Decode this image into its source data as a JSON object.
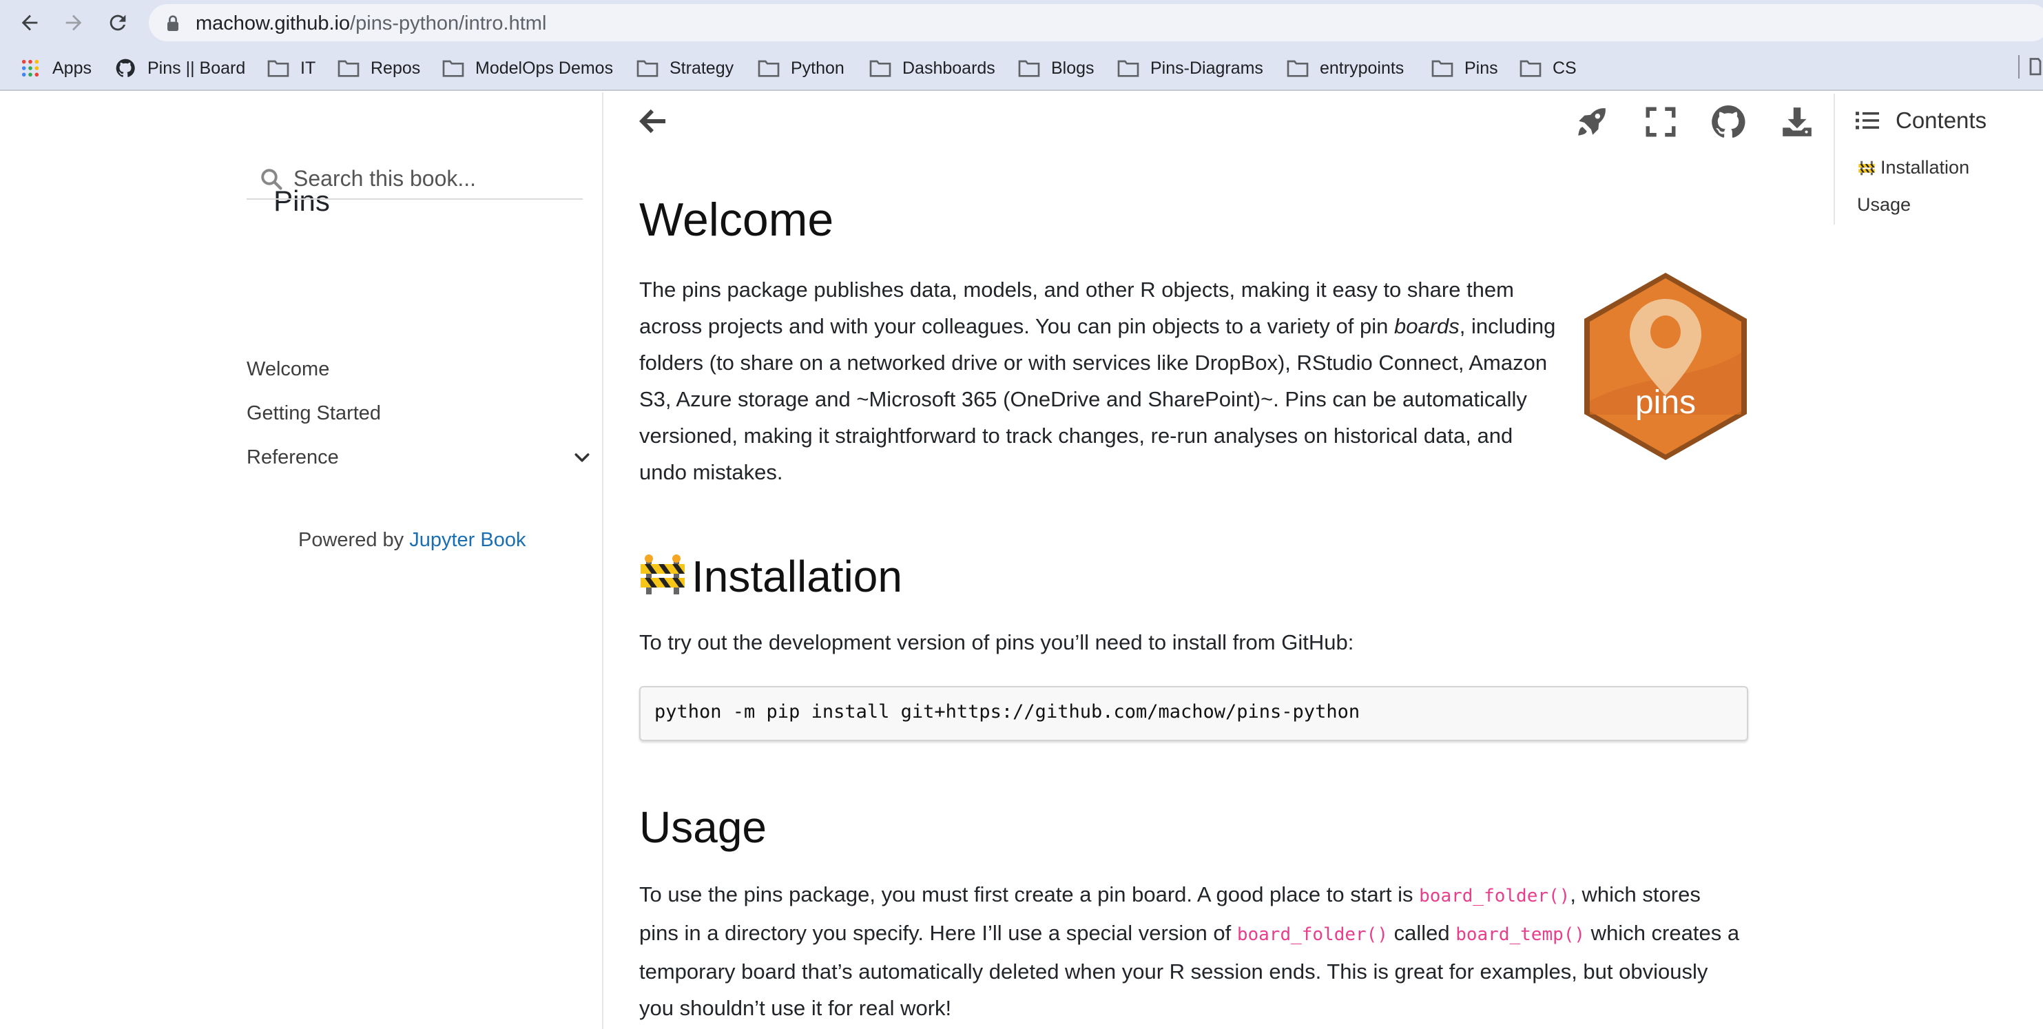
{
  "browser": {
    "url_host": "machow.github.io",
    "url_path": "/pins-python/intro.html",
    "bookmarks": [
      "Apps",
      "Pins || Board",
      "IT",
      "Repos",
      "ModelOps Demos",
      "Strategy",
      "Python",
      "Dashboards",
      "Blogs",
      "Pins-Diagrams",
      "entrypoints",
      "Pins",
      "CS"
    ]
  },
  "sidebar": {
    "site_title": "Pins",
    "search_placeholder": "Search this book...",
    "nav": [
      "Welcome",
      "Getting Started",
      "Reference"
    ],
    "powered_prefix": "Powered by ",
    "powered_link": "Jupyter Book"
  },
  "toc": {
    "title": "Contents",
    "items": [
      "Installation",
      "Usage"
    ]
  },
  "content": {
    "welcome_title": "Welcome",
    "welcome_p1": "The pins package publishes data, models, and other R objects, making it easy to share them across projects and with your colleagues. You can pin objects to a variety of pin ",
    "welcome_em": "boards",
    "welcome_p2": ", including folders (to share on a networked drive or with services like DropBox), RStudio Connect, Amazon S3, Azure storage and ~Microsoft 365 (OneDrive and SharePoint)~. Pins can be automatically versioned, making it straightforward to track changes, re-run analyses on historical data, and undo mistakes.",
    "logo_text": "pins",
    "install_title": "Installation",
    "install_text": "To try out the development version of pins you’ll need to install from GitHub:",
    "install_code": "python -m pip install git+https://github.com/machow/pins-python",
    "usage_title": "Usage",
    "usage_t1": "To use the pins package, you must first create a pin board. A good place to start is ",
    "usage_c1": "board_folder()",
    "usage_t2": ", which stores pins in a directory you specify. Here I’ll use a special version of ",
    "usage_c2": "board_folder()",
    "usage_t3": " called ",
    "usage_c3": "board_temp()",
    "usage_t4": " which creates a temporary board that’s automatically deleted when your R session ends. This is great for examples, but obviously you shouldn’t use it for real work!"
  },
  "colors": {
    "chrome": "#dfe4f3",
    "link": "#1a6fb3",
    "inline_code": "#e83e8c",
    "logo_orange": "#e27e2e"
  }
}
